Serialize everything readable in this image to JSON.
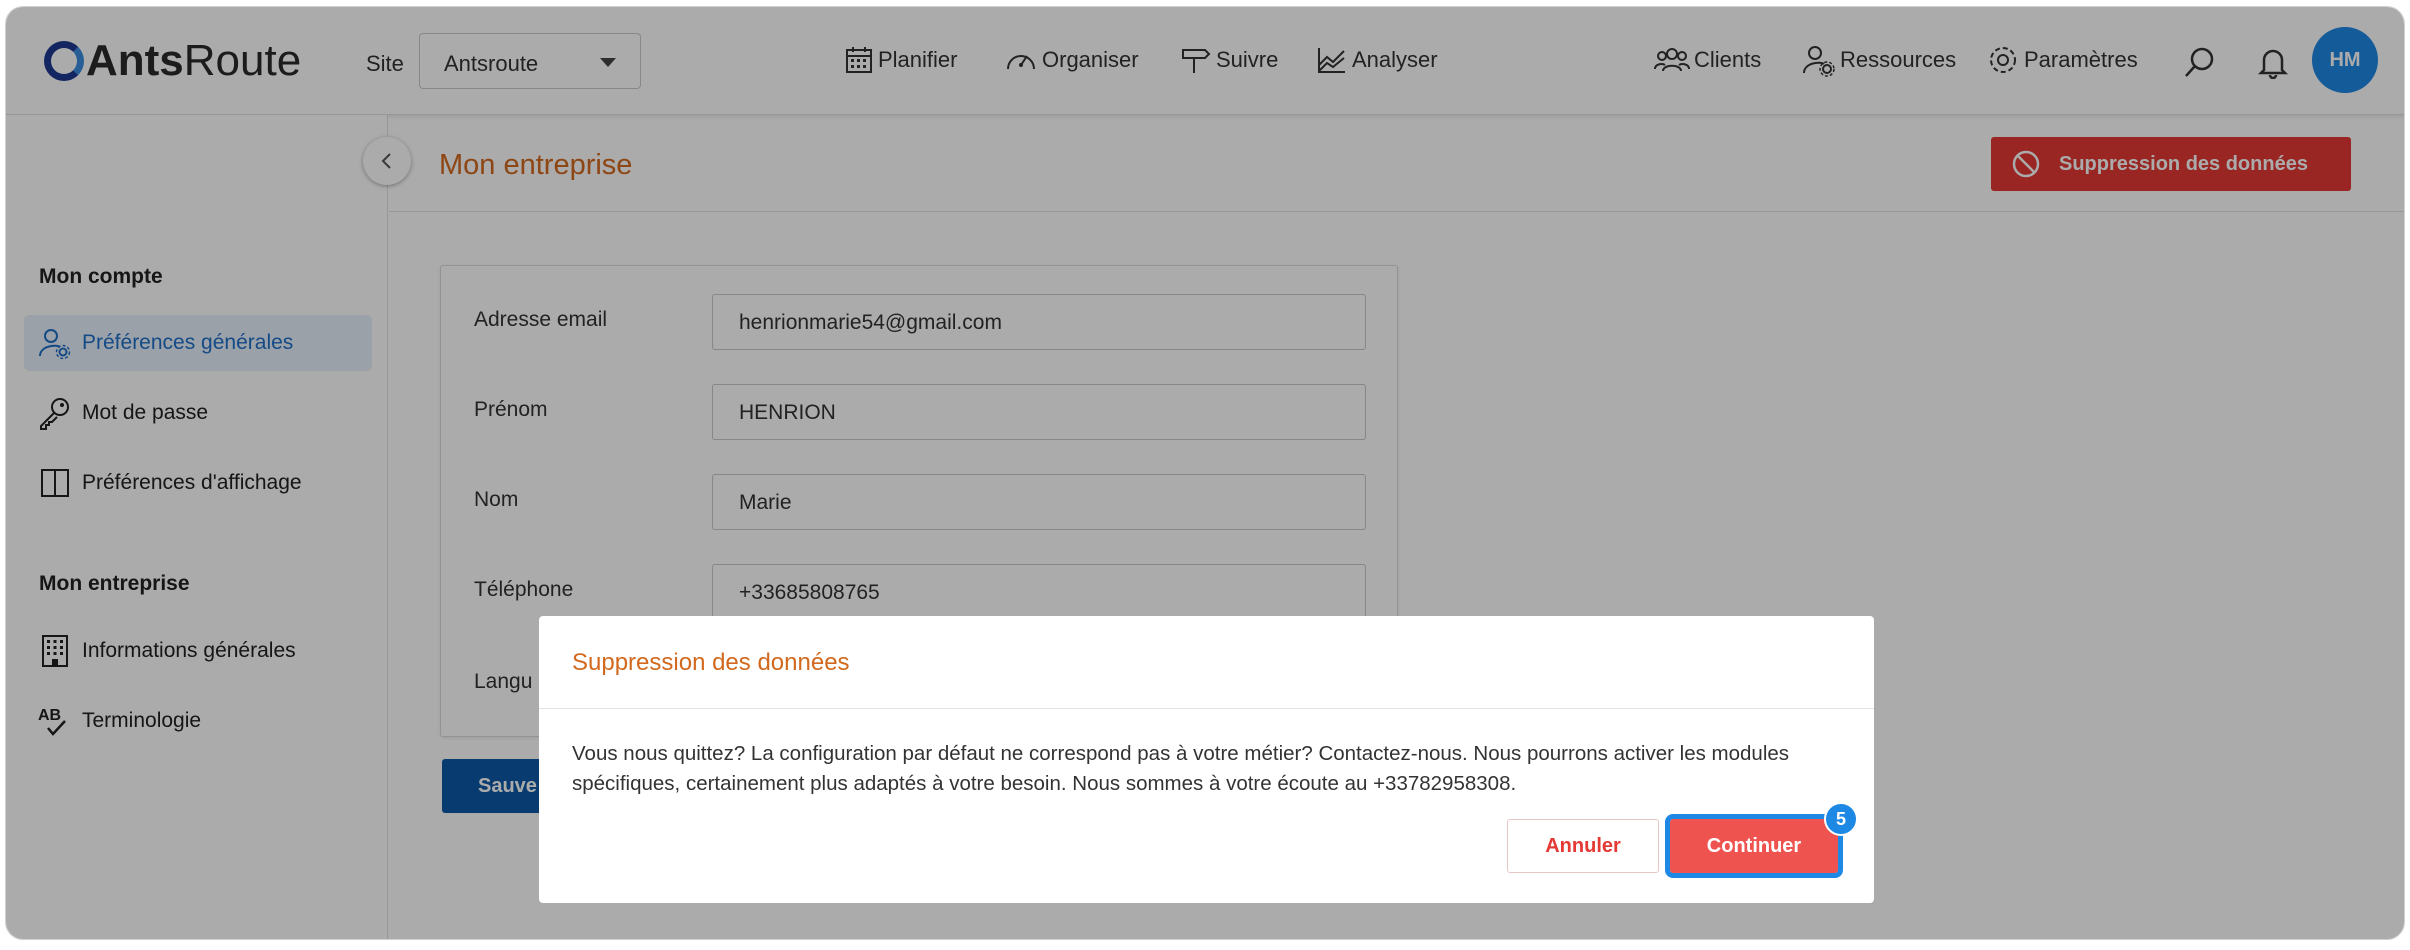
{
  "brand": {
    "name_bold": "Ants",
    "name_regular": "Route"
  },
  "header": {
    "site_label": "Site",
    "site_value": "Antsroute",
    "nav": [
      "Planifier",
      "Organiser",
      "Suivre",
      "Analyser"
    ],
    "right_nav": [
      "Clients",
      "Ressources",
      "Paramètres"
    ],
    "avatar_initials": "HM"
  },
  "sidebar": {
    "section1": "Mon compte",
    "account_items": [
      {
        "label": "Préférences générales",
        "icon": "user-gear-icon"
      },
      {
        "label": "Mot de passe",
        "icon": "key-icon"
      },
      {
        "label": "Préférences d'affichage",
        "icon": "columns-icon"
      }
    ],
    "section2": "Mon entreprise",
    "company_items": [
      {
        "label": "Informations générales",
        "icon": "building-icon"
      },
      {
        "label": "Terminologie",
        "icon": "spellcheck-icon"
      }
    ]
  },
  "page": {
    "title": "Mon entreprise",
    "delete_button": "Suppression des données"
  },
  "form": {
    "email_label": "Adresse email",
    "email_value": "henrionmarie54@gmail.com",
    "firstname_label": "Prénom",
    "firstname_value": "HENRION",
    "lastname_label": "Nom",
    "lastname_value": "Marie",
    "phone_label": "Téléphone",
    "phone_value": "+33685808765",
    "language_label_partial": "Langu",
    "save_partial": "Sauve"
  },
  "modal": {
    "title": "Suppression des données",
    "body": "Vous nous quittez? La configuration par défaut ne correspond pas à votre métier? Contactez-nous. Nous pourrons activer les modules spécifiques, certainement plus adaptés à votre besoin. Nous sommes à votre écoute au +33782958308.",
    "cancel": "Annuler",
    "confirm": "Continuer",
    "step_badge": "5"
  },
  "colors": {
    "accent_orange": "#d2691e",
    "danger": "#e53935",
    "primary_blue": "#0d5aa7",
    "highlight": "#1e88e5"
  }
}
